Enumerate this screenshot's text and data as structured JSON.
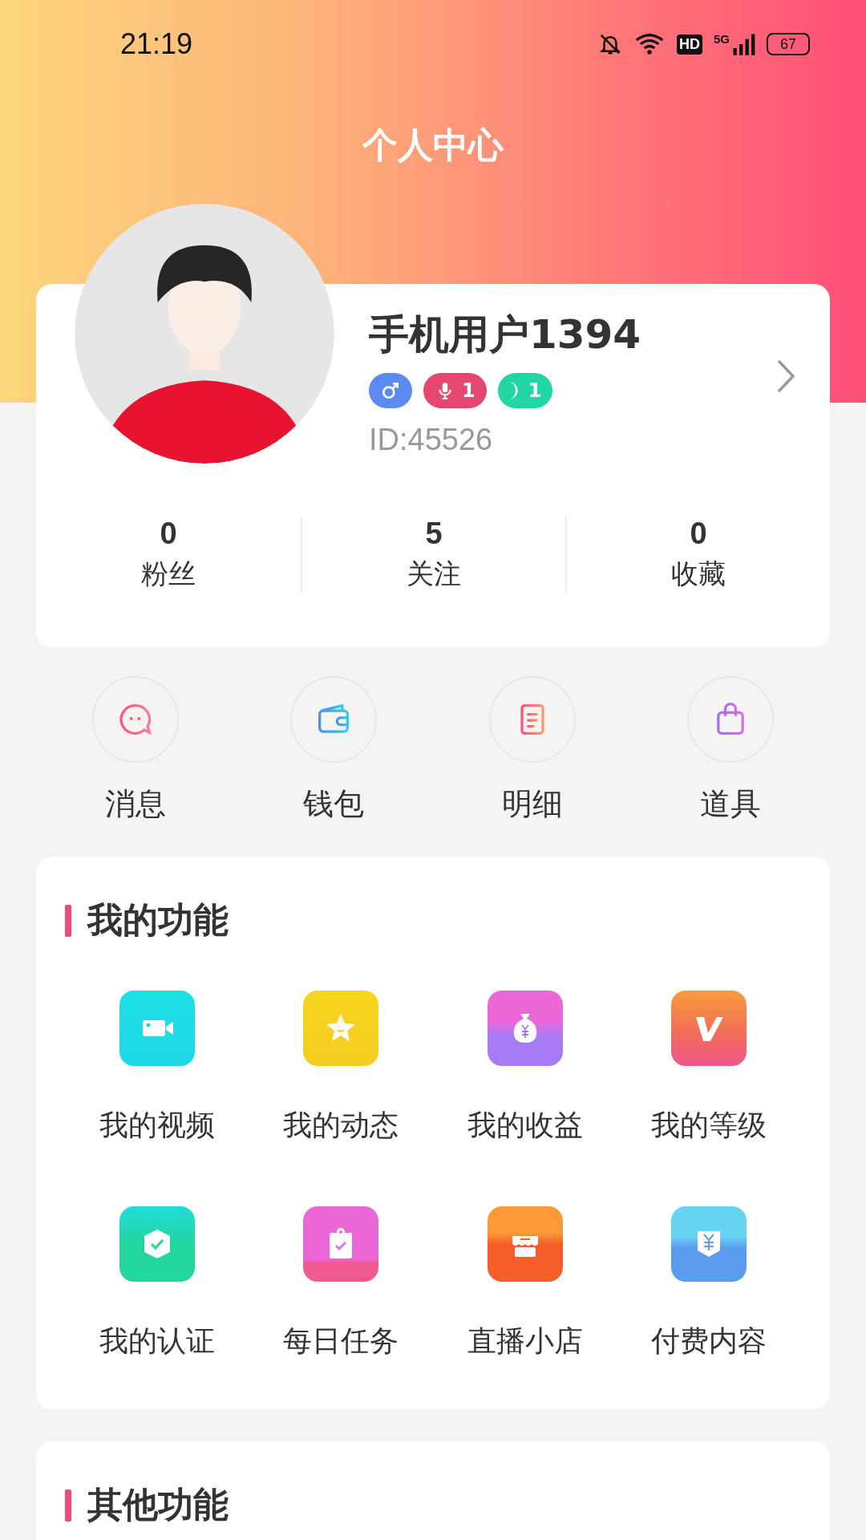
{
  "status_bar": {
    "time": "21:19",
    "hd": "HD",
    "network": "5G",
    "battery": "67"
  },
  "header": {
    "title": "个人中心"
  },
  "profile": {
    "name": "手机用户1394",
    "id": "ID:45526",
    "badges": [
      {
        "kind": "gender",
        "color": "#5b8bf0"
      },
      {
        "kind": "voice",
        "text": "1",
        "color": "#e6476e"
      },
      {
        "kind": "moon",
        "text": "1",
        "color": "#22d6a4"
      }
    ],
    "stats": [
      {
        "value": "0",
        "label": "粉丝"
      },
      {
        "value": "5",
        "label": "关注"
      },
      {
        "value": "0",
        "label": "收藏"
      }
    ]
  },
  "quick_actions": [
    {
      "kind": "message",
      "label": "消息"
    },
    {
      "kind": "wallet",
      "label": "钱包"
    },
    {
      "kind": "list",
      "label": "明细"
    },
    {
      "kind": "bag",
      "label": "道具"
    }
  ],
  "sections": [
    {
      "title": "我的功能",
      "items": [
        {
          "kind": "video",
          "label": "我的视频"
        },
        {
          "kind": "star",
          "label": "我的动态"
        },
        {
          "kind": "money",
          "label": "我的收益"
        },
        {
          "kind": "vip",
          "label": "我的等级"
        },
        {
          "kind": "shield",
          "label": "我的认证"
        },
        {
          "kind": "task",
          "label": "每日任务"
        },
        {
          "kind": "shop",
          "label": "直播小店"
        },
        {
          "kind": "paid",
          "label": "付费内容"
        }
      ]
    },
    {
      "title": "其他功能"
    }
  ]
}
